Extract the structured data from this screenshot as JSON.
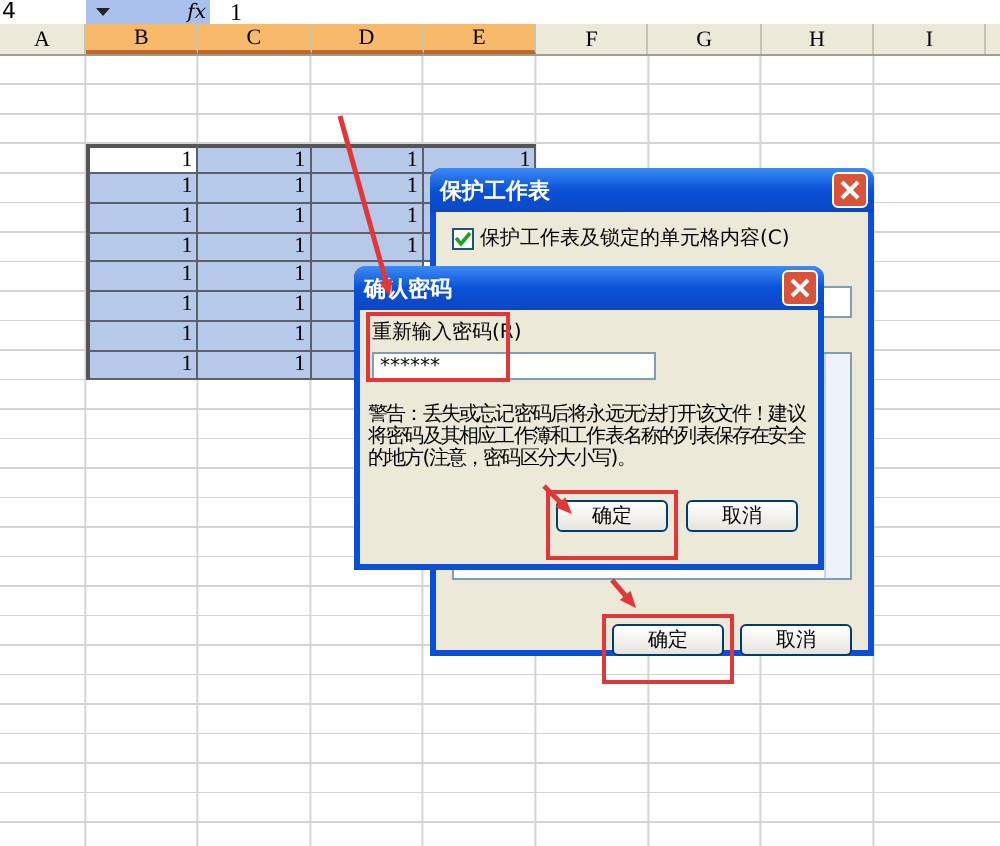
{
  "formula_bar": {
    "name_box": "4",
    "function_symbol": "fx",
    "value": "1"
  },
  "sheet": {
    "columns": [
      {
        "label": "A",
        "selected": false
      },
      {
        "label": "B",
        "selected": true
      },
      {
        "label": "C",
        "selected": true
      },
      {
        "label": "D",
        "selected": true
      },
      {
        "label": "E",
        "selected": true
      },
      {
        "label": "F",
        "selected": false
      },
      {
        "label": "G",
        "selected": false
      },
      {
        "label": "H",
        "selected": false
      },
      {
        "label": "I",
        "selected": false
      }
    ],
    "data_rows": [
      {
        "cells": [
          {
            "value": "1",
            "active": true
          },
          {
            "value": "1",
            "active": false
          },
          {
            "value": "1",
            "active": false
          },
          {
            "value": "1",
            "active": false
          }
        ]
      },
      {
        "cells": [
          {
            "value": "1",
            "active": false
          },
          {
            "value": "1",
            "active": false
          },
          {
            "value": "1",
            "active": false
          }
        ]
      },
      {
        "cells": [
          {
            "value": "1",
            "active": false
          },
          {
            "value": "1",
            "active": false
          },
          {
            "value": "1",
            "active": false
          }
        ]
      },
      {
        "cells": [
          {
            "value": "1",
            "active": false
          },
          {
            "value": "1",
            "active": false
          },
          {
            "value": "1",
            "active": false
          }
        ]
      },
      {
        "cells": [
          {
            "value": "1",
            "active": false
          },
          {
            "value": "1",
            "active": false
          }
        ]
      },
      {
        "cells": [
          {
            "value": "1",
            "active": false
          },
          {
            "value": "1",
            "active": false
          }
        ]
      },
      {
        "cells": [
          {
            "value": "1",
            "active": false
          },
          {
            "value": "1",
            "active": false
          }
        ]
      },
      {
        "cells": [
          {
            "value": "1",
            "active": false
          },
          {
            "value": "1",
            "active": false
          }
        ]
      }
    ]
  },
  "protect_dialog": {
    "title": "保护工作表",
    "protect_checkbox": {
      "label": "保护工作表及锁定的单元格内容(C)",
      "checked": true
    },
    "buttons": [
      {
        "label": "确定",
        "highlighted": true
      },
      {
        "label": "取消",
        "highlighted": false
      }
    ]
  },
  "confirm_dialog": {
    "title": "确认密码",
    "field_label": "重新输入密码(R)",
    "value": "******",
    "field_highlighted": true,
    "warning": "警告：丢失或忘记密码后将永远无法打开该文件！建议将密码及其相应工作簿和工作表名称的列表保存在安全的地方(注意，密码区分大小写)。",
    "buttons": [
      {
        "label": "确定",
        "highlighted": true
      },
      {
        "label": "取消",
        "highlighted": false
      }
    ]
  }
}
